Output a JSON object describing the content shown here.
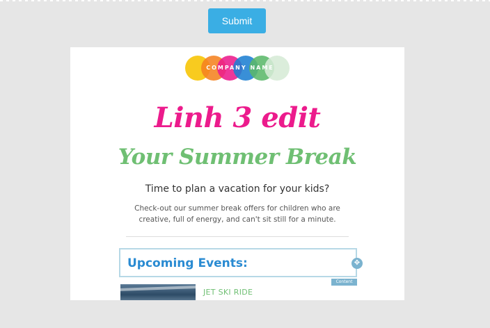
{
  "toolbar": {
    "submit_label": "Submit"
  },
  "email": {
    "logo": {
      "text": "COMPANY NAME",
      "circle_colors": [
        "#f7c400",
        "#f58220",
        "#ec1b8c",
        "#1e7fd2",
        "#5bb86a",
        "#d6ead6"
      ]
    },
    "title_line1": "Linh 3 edit",
    "title_line2": "Your Summer Break",
    "subheading": "Time to plan a vacation for your kids?",
    "body": "Check-out our summer break offers for children who are creative, full of energy, and can't sit still for a minute.",
    "events_heading": "Upcoming Events:",
    "content_tag": "Content",
    "events": [
      {
        "title": "JET SKI RIDE"
      }
    ]
  },
  "colors": {
    "background": "#e6e6e6",
    "submit": "#3aaee4",
    "title_pink": "#ec1b8c",
    "title_green": "#6fbf73",
    "events_blue": "#2a8bd2",
    "selection_border": "#b6d8e6"
  }
}
